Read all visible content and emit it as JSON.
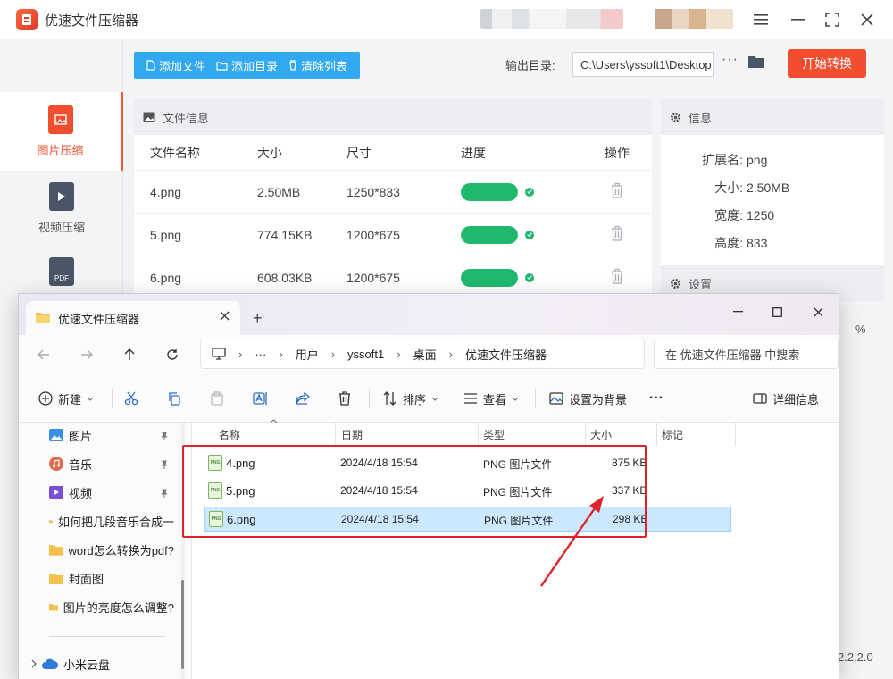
{
  "app": {
    "title": "优速文件压缩器",
    "toolbar": {
      "add_file": "添加文件",
      "add_dir": "添加目录",
      "clear_list": "清除列表",
      "output_label": "输出目录:",
      "output_path": "C:\\Users\\yssoft1\\Desktop",
      "start": "开始转换"
    },
    "sidebar": [
      {
        "label": "图片压缩",
        "active": true
      },
      {
        "label": "视频压缩",
        "active": false
      },
      {
        "label": "PDF"
      }
    ],
    "file_panel": {
      "title": "文件信息",
      "columns": [
        "文件名称",
        "大小",
        "尺寸",
        "进度",
        "操作"
      ],
      "rows": [
        {
          "name": "4.png",
          "size": "2.50MB",
          "dim": "1250*833",
          "progress": 1.0
        },
        {
          "name": "5.png",
          "size": "774.15KB",
          "dim": "1200*675",
          "progress": 1.0
        },
        {
          "name": "6.png",
          "size": "608.03KB",
          "dim": "1200*675",
          "progress": 1.0
        }
      ]
    },
    "info_panel": {
      "title": "信息",
      "rows": [
        {
          "k": "扩展名:",
          "v": "png"
        },
        {
          "k": "大小:",
          "v": "2.50MB"
        },
        {
          "k": "宽度:",
          "v": "1250"
        },
        {
          "k": "高度:",
          "v": "833"
        }
      ]
    },
    "settings_title": "设置",
    "percent_unit": "%",
    "version": "2.2.2.0"
  },
  "explorer": {
    "tab_title": "优速文件压缩器",
    "breadcrumb": [
      "用户",
      "yssoft1",
      "桌面",
      "优速文件压缩器"
    ],
    "breadcrumb_more": "···",
    "search_placeholder": "在 优速文件压缩器 中搜索",
    "commands": {
      "new": "新建",
      "sort": "排序",
      "view": "查看",
      "set_bg": "设置为背景",
      "more": "···",
      "details": "详细信息"
    },
    "nav": [
      {
        "label": "图片",
        "pinned": true
      },
      {
        "label": "音乐",
        "pinned": true
      },
      {
        "label": "视频",
        "pinned": true
      },
      {
        "label": "如何把几段音乐合成一"
      },
      {
        "label": "word怎么转换为pdf?"
      },
      {
        "label": "封面图"
      },
      {
        "label": "图片的亮度怎么调整?"
      },
      {
        "label": "小米云盘"
      }
    ],
    "columns": [
      "名称",
      "日期",
      "类型",
      "大小",
      "标记"
    ],
    "files": [
      {
        "name": "4.png",
        "date": "2024/4/18 15:54",
        "type": "PNG 图片文件",
        "size": "875 KB",
        "selected": false
      },
      {
        "name": "5.png",
        "date": "2024/4/18 15:54",
        "type": "PNG 图片文件",
        "size": "337 KB",
        "selected": false
      },
      {
        "name": "6.png",
        "date": "2024/4/18 15:54",
        "type": "PNG 图片文件",
        "size": "298 KB",
        "selected": true
      }
    ],
    "png_badge": "PNG"
  },
  "colors": {
    "accent_orange": "#f25430",
    "toolbar_blue": "#31a8ef",
    "progress_green": "#1fb86e",
    "annotation_red": "#e0232a",
    "selection": "#cce8ff"
  }
}
